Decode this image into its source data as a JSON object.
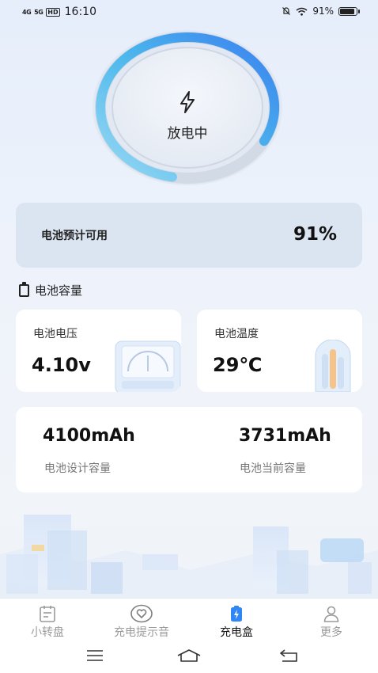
{
  "status_bar": {
    "signal1": "4G",
    "signal2": "5G",
    "hd": "HD",
    "time": "16:10",
    "battery": "91%",
    "battery_level": 0.91
  },
  "ring": {
    "status": "放电中",
    "level": 0.91,
    "colors": {
      "start": "#9ad9f3",
      "mid": "#4cb8ec",
      "end": "#3a7ff0"
    }
  },
  "remaining": {
    "label": "电池预计可用",
    "value": "91%"
  },
  "capacity_section": {
    "title": "电池容量"
  },
  "voltage": {
    "label": "电池电压",
    "value": "4.10v"
  },
  "temperature": {
    "label": "电池温度",
    "value": "29℃"
  },
  "capacity": {
    "design_value": "4100mAh",
    "design_label": "电池设计容量",
    "current_value": "3731mAh",
    "current_label": "电池当前容量"
  },
  "tabs": [
    {
      "label": "小转盘",
      "icon": "notepad-icon",
      "active": false
    },
    {
      "label": "充电提示音",
      "icon": "heart-icon",
      "active": false
    },
    {
      "label": "充电盒",
      "icon": "battery-charging-icon",
      "active": true
    },
    {
      "label": "更多",
      "icon": "person-icon",
      "active": false
    }
  ],
  "accent_color": "#2f86f6"
}
